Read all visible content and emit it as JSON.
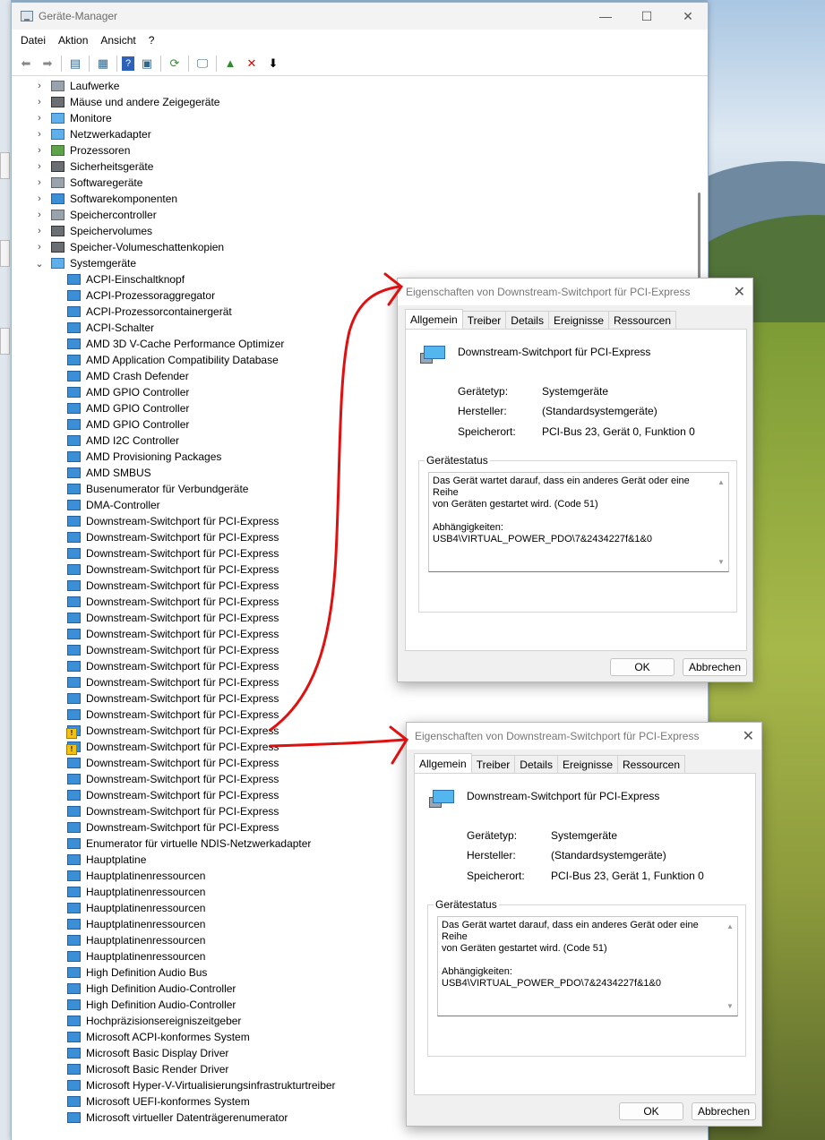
{
  "window": {
    "title": "Geräte-Manager",
    "controls": {
      "minimize": "—",
      "maximize": "☐",
      "close": "✕"
    }
  },
  "menu": [
    "Datei",
    "Aktion",
    "Ansicht",
    "?"
  ],
  "toolbar_icons": [
    "back-arrow-icon",
    "forward-arrow-icon",
    "properties-icon",
    "help-icon",
    "scan-icon",
    "monitor-icon",
    "update-driver-icon",
    "uninstall-icon",
    "disable-icon"
  ],
  "categories": [
    {
      "label": "Laufwerke",
      "icon": "gray"
    },
    {
      "label": "Mäuse und andere Zeigegeräte",
      "icon": "dark"
    },
    {
      "label": "Monitore",
      "icon": "mon"
    },
    {
      "label": "Netzwerkadapter",
      "icon": "mon"
    },
    {
      "label": "Prozessoren",
      "icon": "green"
    },
    {
      "label": "Sicherheitsgeräte",
      "icon": "dark"
    },
    {
      "label": "Softwaregeräte",
      "icon": "gray"
    },
    {
      "label": "Softwarekomponenten",
      "icon": "blue"
    },
    {
      "label": "Speichercontroller",
      "icon": "gray"
    },
    {
      "label": "Speichervolumes",
      "icon": "dark"
    },
    {
      "label": "Speicher-Volumeschattenkopien",
      "icon": "dark"
    }
  ],
  "expanded_category": "Systemgeräte",
  "system_devices": [
    "ACPI-Einschaltknopf",
    "ACPI-Prozessoraggregator",
    "ACPI-Prozessorcontainergerät",
    "ACPI-Schalter",
    "AMD 3D V-Cache Performance Optimizer",
    "AMD Application Compatibility Database",
    "AMD Crash Defender",
    "AMD GPIO Controller",
    "AMD GPIO Controller",
    "AMD GPIO Controller",
    "AMD I2C Controller",
    "AMD Provisioning Packages",
    "AMD SMBUS",
    "Busenumerator für Verbundgeräte",
    "DMA-Controller",
    "Downstream-Switchport für PCI-Express",
    "Downstream-Switchport für PCI-Express",
    "Downstream-Switchport für PCI-Express",
    "Downstream-Switchport für PCI-Express",
    "Downstream-Switchport für PCI-Express",
    "Downstream-Switchport für PCI-Express",
    "Downstream-Switchport für PCI-Express",
    "Downstream-Switchport für PCI-Express",
    "Downstream-Switchport für PCI-Express",
    "Downstream-Switchport für PCI-Express",
    "Downstream-Switchport für PCI-Express",
    "Downstream-Switchport für PCI-Express",
    "Downstream-Switchport für PCI-Express",
    "Downstream-Switchport für PCI-Express",
    "Downstream-Switchport für PCI-Express",
    "Downstream-Switchport für PCI-Express",
    "Downstream-Switchport für PCI-Express",
    "Downstream-Switchport für PCI-Express",
    "Downstream-Switchport für PCI-Express",
    "Downstream-Switchport für PCI-Express",
    "Enumerator für virtuelle NDIS-Netzwerkadapter",
    "Hauptplatine",
    "Hauptplatinenressourcen",
    "Hauptplatinenressourcen",
    "Hauptplatinenressourcen",
    "Hauptplatinenressourcen",
    "Hauptplatinenressourcen",
    "Hauptplatinenressourcen",
    "High Definition Audio Bus",
    "High Definition Audio-Controller",
    "High Definition Audio-Controller",
    "Hochpräzisionsereigniszeitgeber",
    "Microsoft ACPI-konformes System",
    "Microsoft Basic Display Driver",
    "Microsoft Basic Render Driver",
    "Microsoft Hyper-V-Virtualisierungsinfrastrukturtreiber",
    "Microsoft UEFI-konformes System",
    "Microsoft virtueller Datenträgerenumerator"
  ],
  "warning_rows": [
    28,
    29
  ],
  "dialogs": [
    {
      "title": "Eigenschaften von Downstream-Switchport für PCI-Express",
      "tabs": [
        "Allgemein",
        "Treiber",
        "Details",
        "Ereignisse",
        "Ressourcen"
      ],
      "device_name": "Downstream-Switchport für PCI-Express",
      "props": [
        {
          "label": "Gerätetyp:",
          "value": "Systemgeräte"
        },
        {
          "label": "Hersteller:",
          "value": "(Standardsystemgeräte)"
        },
        {
          "label": "Speicherort:",
          "value": "PCI-Bus 23, Gerät 0, Funktion 0"
        }
      ],
      "status_legend": "Gerätestatus",
      "status_text": "Das Gerät wartet darauf, dass ein anderes Gerät oder eine Reihe\nvon Geräten gestartet wird. (Code 51)\n\nAbhängigkeiten:\nUSB4\\VIRTUAL_POWER_PDO\\7&2434227f&1&0",
      "ok": "OK",
      "cancel": "Abbrechen"
    },
    {
      "title": "Eigenschaften von Downstream-Switchport für PCI-Express",
      "tabs": [
        "Allgemein",
        "Treiber",
        "Details",
        "Ereignisse",
        "Ressourcen"
      ],
      "device_name": "Downstream-Switchport für PCI-Express",
      "props": [
        {
          "label": "Gerätetyp:",
          "value": "Systemgeräte"
        },
        {
          "label": "Hersteller:",
          "value": "(Standardsystemgeräte)"
        },
        {
          "label": "Speicherort:",
          "value": "PCI-Bus 23, Gerät 1, Funktion 0"
        }
      ],
      "status_legend": "Gerätestatus",
      "status_text": "Das Gerät wartet darauf, dass ein anderes Gerät oder eine Reihe\nvon Geräten gestartet wird. (Code 51)\n\nAbhängigkeiten:\nUSB4\\VIRTUAL_POWER_PDO\\7&2434227f&1&0",
      "ok": "OK",
      "cancel": "Abbrechen"
    }
  ],
  "annotation_color": "#e01010"
}
